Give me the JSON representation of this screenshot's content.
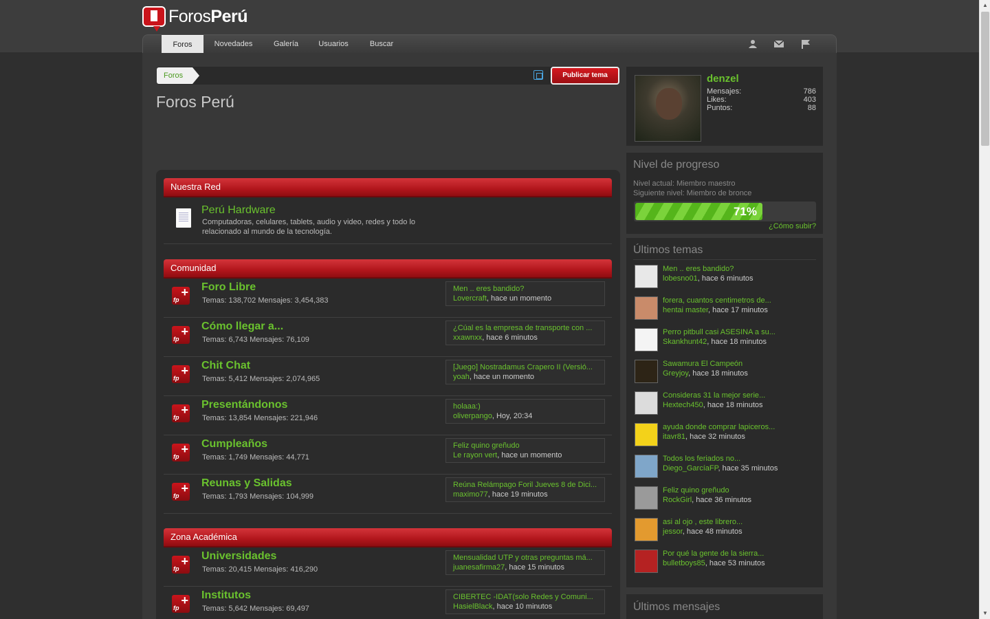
{
  "app": {
    "logo_text_light": "Foros",
    "logo_text_bold": "Perú"
  },
  "nav": {
    "tabs": [
      "Foros",
      "Novedades",
      "Galería",
      "Usuarios",
      "Buscar"
    ],
    "icons": [
      "user-icon",
      "mail-icon",
      "flag-icon"
    ]
  },
  "breadcrumb": {
    "item": "Foros"
  },
  "toolbar": {
    "publish_label": "Publicar tema"
  },
  "page": {
    "title": "Foros Perú"
  },
  "categories": [
    {
      "name": "Nuestra Red"
    },
    {
      "name": "Comunidad"
    },
    {
      "name": "Zona Académica"
    }
  ],
  "network_forum": {
    "title": "Perú Hardware",
    "description": "Computadoras, celulares, tablets, audio y video, redes y todo lo relacionado al mundo de la tecnología."
  },
  "forums": [
    {
      "title": "Foro Libre",
      "stats": "Temas: 138,702 Mensajes: 3,454,383",
      "last_title": "Men .. eres bandido?",
      "last_user": "Lovercraft",
      "last_time": ", hace un momento"
    },
    {
      "title": "Cómo llegar a...",
      "stats": "Temas: 6,743 Mensajes: 76,109",
      "last_title": "¿Cúal es la empresa de transporte con ...",
      "last_user": "xxawnxx",
      "last_time": ", hace 6 minutos"
    },
    {
      "title": "Chit Chat",
      "stats": "Temas: 5,412 Mensajes: 2,074,965",
      "last_title": "[Juego] Nostradamus Crapero II (Versió...",
      "last_user": "yoah",
      "last_time": ", hace un momento"
    },
    {
      "title": "Presentándonos",
      "stats": "Temas: 13,854 Mensajes: 221,946",
      "last_title": "holaaa:)",
      "last_user": "oliverpango",
      "last_time": ", Hoy, 20:34"
    },
    {
      "title": "Cumpleaños",
      "stats": "Temas: 1,749 Mensajes: 44,771",
      "last_title": "Feliz quino greñudo",
      "last_user": "Le rayon vert",
      "last_time": ", hace un momento"
    },
    {
      "title": "Reunas y Salidas",
      "stats": "Temas: 1,793 Mensajes: 104,999",
      "last_title": "Reúna Relámpago Foril Jueves 8 de Dici...",
      "last_user": "maximo77",
      "last_time": ", hace 19 minutos"
    },
    {
      "title": "Universidades",
      "stats": "Temas: 20,415 Mensajes: 416,290",
      "last_title": "Mensualidad UTP y otras preguntas má...",
      "last_user": "juanesafirma27",
      "last_time": ", hace 15 minutos"
    },
    {
      "title": "Institutos",
      "stats": "Temas: 5,642 Mensajes: 69,497",
      "last_title": "CIBERTEC -IDAT(solo Redes y Comuni...",
      "last_user": "HasielBlack",
      "last_time": ", hace 10 minutos"
    }
  ],
  "user": {
    "name": "denzel",
    "stats": [
      {
        "label": "Mensajes:",
        "value": "786"
      },
      {
        "label": "Likes:",
        "value": "403"
      },
      {
        "label": "Puntos:",
        "value": "88"
      }
    ]
  },
  "progress": {
    "title": "Nivel de progreso",
    "current": "Nivel actual: Miembro maestro",
    "next": "Siguiente nivel: Miembro de bronce",
    "percent": 71,
    "percent_label": "71%",
    "how_label": "¿Cómo subir?"
  },
  "latest_threads": {
    "title": "Últimos temas",
    "items": [
      {
        "title": "Men .. eres bandido?",
        "user": "lobesno01",
        "time": ", hace 6 minutos",
        "avatar_color": "#e8e8e8"
      },
      {
        "title": "forera, cuantos centimetros de...",
        "user": "hentai master",
        "time": ", hace 17 minutos",
        "avatar_color": "#c98b6a"
      },
      {
        "title": "Perro pitbull casi ASESINA a su...",
        "user": "Skankhunt42",
        "time": ", hace 18 minutos",
        "avatar_color": "#f4f4f4"
      },
      {
        "title": "Sawamura El Campeón",
        "user": "Greyjoy",
        "time": ", hace 18 minutos",
        "avatar_color": "#2d2416"
      },
      {
        "title": "Consideras 31 la mejor serie...",
        "user": "Hextech450",
        "time": ", hace 18 minutos",
        "avatar_color": "#dcdcdc"
      },
      {
        "title": "ayuda donde comprar lapiceros...",
        "user": "itavr81",
        "time": ", hace 32 minutos",
        "avatar_color": "#f3d21a"
      },
      {
        "title": "Todos los feriados no...",
        "user": "Diego_GarcíaFP",
        "time": ", hace 35 minutos",
        "avatar_color": "#7fa6c9"
      },
      {
        "title": "Feliz quino greñudo",
        "user": "RockGirl",
        "time": ", hace 36 minutos",
        "avatar_color": "#9a9a9a"
      },
      {
        "title": "asi al ojo , este librero...",
        "user": "jessor",
        "time": ", hace 48 minutos",
        "avatar_color": "#e39a2f"
      },
      {
        "title": "Por qué la gente de la sierra...",
        "user": "bulletboys85",
        "time": ", hace 53 minutos",
        "avatar_color": "#b52222"
      }
    ]
  },
  "latest_posts": {
    "title": "Últimos mensajes"
  },
  "colors": {
    "accent_green": "#6ac22e",
    "brand_red": "#c9141b",
    "bg_dark": "#2f2f2f"
  }
}
